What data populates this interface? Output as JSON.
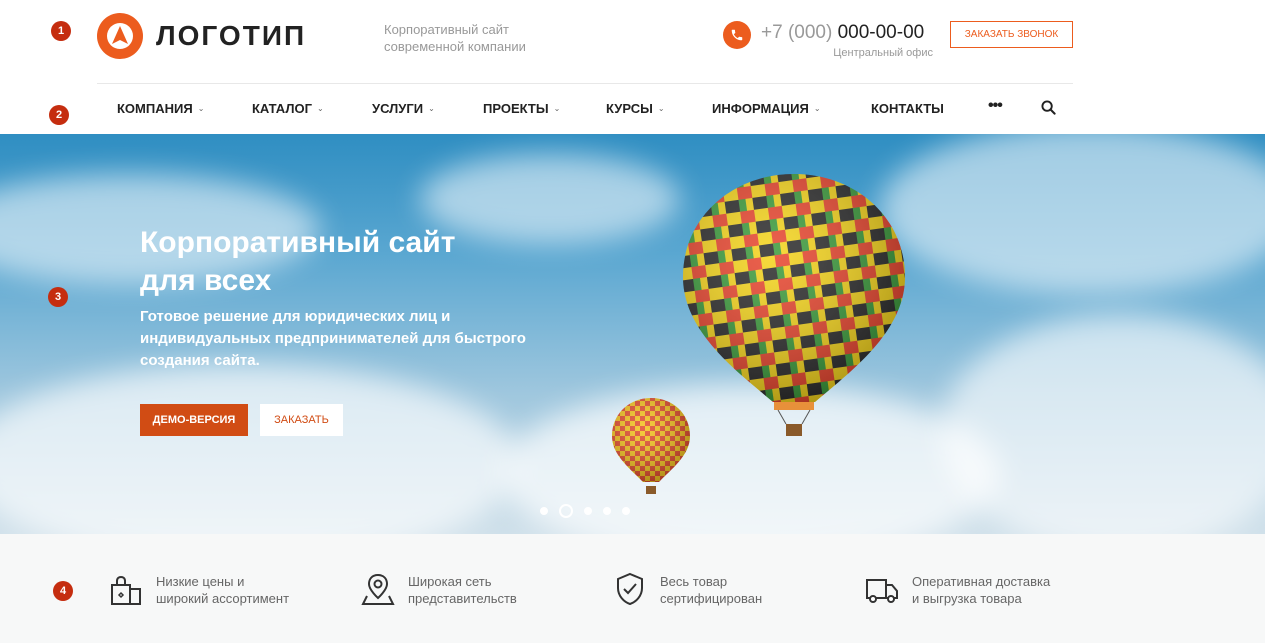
{
  "markers": [
    "1",
    "2",
    "3",
    "4"
  ],
  "header": {
    "logo_text": "ЛОГОТИП",
    "tagline_line1": "Корпоративный сайт",
    "tagline_line2": "современной компании",
    "phone_prefix": "+7 (000)",
    "phone_number": "000-00-00",
    "office_label": "Центральный офис",
    "callback_label": "Заказать звонок"
  },
  "nav": {
    "items": [
      {
        "label": "КОМПАНИЯ",
        "has_dropdown": true
      },
      {
        "label": "КАТАЛОГ",
        "has_dropdown": true
      },
      {
        "label": "УСЛУГИ",
        "has_dropdown": true
      },
      {
        "label": "ПРОЕКТЫ",
        "has_dropdown": true
      },
      {
        "label": "КУРСЫ",
        "has_dropdown": true
      },
      {
        "label": "ИНФОРМАЦИЯ",
        "has_dropdown": true
      },
      {
        "label": "КОНТАКТЫ",
        "has_dropdown": false
      }
    ],
    "more_label": "•••",
    "search_icon": "search-icon"
  },
  "hero": {
    "title_line1": "Корпоративный сайт",
    "title_line2": "для всех",
    "text_line1": "Готовое решение для юридических лиц и",
    "text_line2": "индивидуальных предпринимателей для быстрого",
    "text_line3": "создания сайта.",
    "demo_button": "ДЕМО-ВЕРСИЯ",
    "order_button": "ЗАКАЗАТЬ",
    "slide_count": 5,
    "active_slide": 2
  },
  "features": [
    {
      "icon": "shopping-bags-icon",
      "line1": "Низкие цены и",
      "line2": "широкий ассортимент"
    },
    {
      "icon": "map-pin-icon",
      "line1": "Широкая сеть",
      "line2": "представительств"
    },
    {
      "icon": "shield-check-icon",
      "line1": "Весь товар",
      "line2": "сертифицирован"
    },
    {
      "icon": "delivery-truck-icon",
      "line1": "Оперативная доставка",
      "line2": "и выгрузка товара"
    }
  ],
  "colors": {
    "accent": "#ec5c1e",
    "accent_dark": "#d14c14",
    "marker": "#c52d0f",
    "text_dark": "#222222",
    "text_muted": "#999999",
    "features_bg": "#f7f8f8"
  }
}
